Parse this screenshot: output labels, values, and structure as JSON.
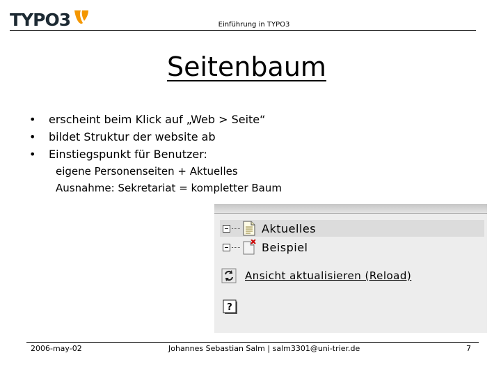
{
  "header": {
    "logo_text": "TYPO3",
    "title": "Einführung in TYPO3"
  },
  "slide": {
    "title": "Seitenbaum",
    "bullets": [
      {
        "text": "erscheint beim Klick auf „Web > Seite“"
      },
      {
        "text": "bildet Struktur der website ab"
      },
      {
        "text": "Einstiegspunkt für Benutzer:"
      }
    ],
    "sub_lines": [
      "eigene Personenseiten + Aktuelles",
      "Ausnahme: Sekretariat = kompletter Baum"
    ]
  },
  "tree_panel": {
    "items": [
      {
        "label": "Aktuelles",
        "icon": "page-icon"
      },
      {
        "label": "Beispiel",
        "icon": "page-hidden-icon"
      }
    ],
    "reload_label": "Ansicht aktualisieren (Reload)",
    "help_icon": "help-icon"
  },
  "footer": {
    "date": "2006-may-02",
    "author": "Johannes Sebastian Salm | salm3301@uni-trier.de",
    "page_number": "7"
  },
  "colors": {
    "logo_orange": "#f49700",
    "panel_bg": "#ededed",
    "selected_row": "#dcdcdc",
    "hidden_mark": "#cc0000"
  }
}
